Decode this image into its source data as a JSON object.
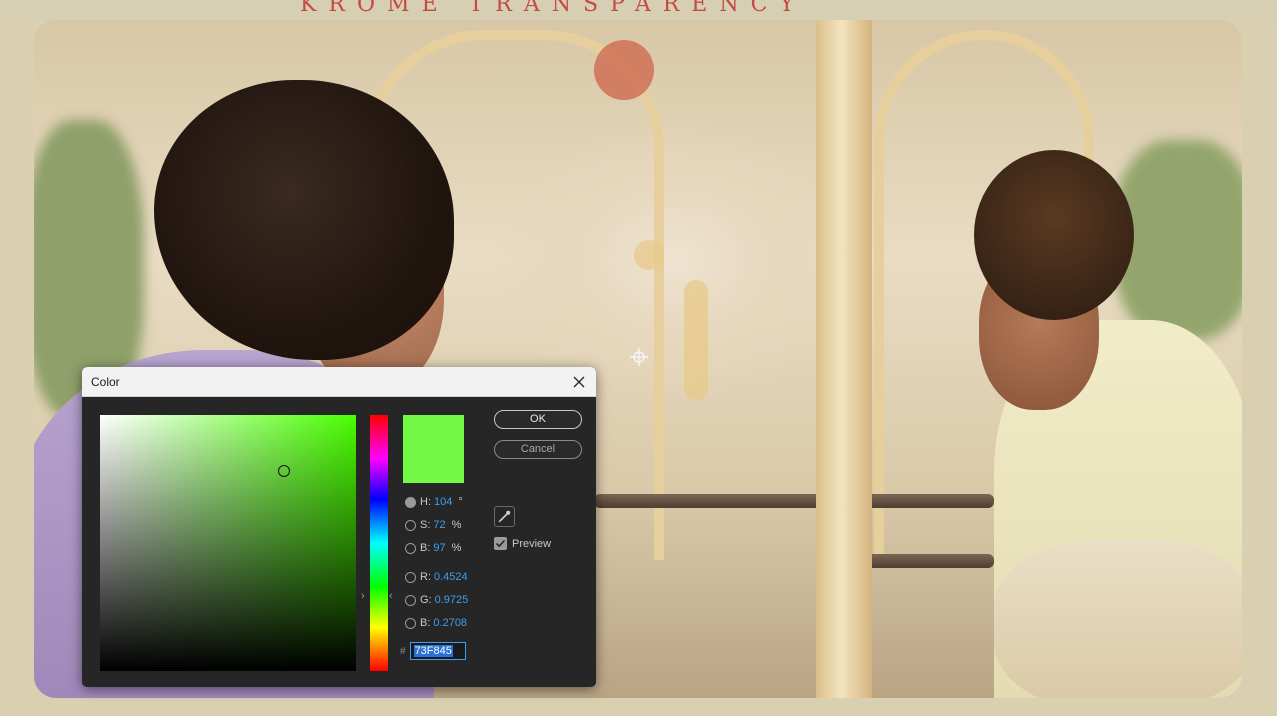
{
  "background": {
    "banner_fragment": "KROME   TRANSPARENCY"
  },
  "dialog": {
    "title": "Color",
    "current_color_hex": "#73F845",
    "hue_color_hex": "#49FF00",
    "fields": {
      "h": {
        "label": "H:",
        "value": "104",
        "unit": "°"
      },
      "s": {
        "label": "S:",
        "value": "72",
        "unit": "%"
      },
      "b": {
        "label": "B:",
        "value": "97",
        "unit": "%"
      },
      "r": {
        "label": "R:",
        "value": "0.4524"
      },
      "g": {
        "label": "G:",
        "value": "0.9725"
      },
      "b2": {
        "label": "B:",
        "value": "0.2708"
      }
    },
    "hex": {
      "prefix": "#",
      "value": "73F845"
    },
    "ok_label": "OK",
    "cancel_label": "Cancel",
    "preview_label": "Preview",
    "preview_checked": true
  }
}
